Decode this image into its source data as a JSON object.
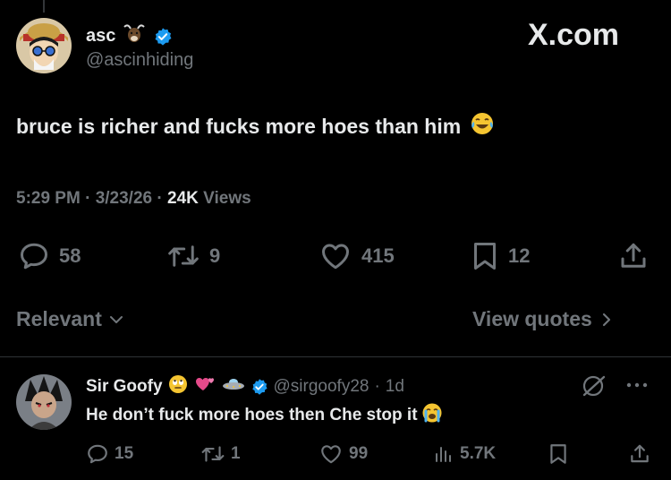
{
  "tweet": {
    "display_name": "asc",
    "handle": "@ascinhiding",
    "text": "bruce is richer and fucks more hoes than him",
    "time": "5:29 PM",
    "date": "3/23/26",
    "views_count": "24K",
    "views_label": "Views",
    "replies": "58",
    "retweets": "9",
    "likes": "415",
    "bookmarks": "12"
  },
  "brand": {
    "logo_text": "X.com"
  },
  "sort": {
    "relevant_label": "Relevant",
    "view_quotes_label": "View quotes"
  },
  "reply": {
    "display_name": "Sir Goofy",
    "handle": "@sirgoofy28",
    "age": "1d",
    "text": "He don’t fuck more hoes then Che stop it",
    "replies": "15",
    "retweets": "1",
    "likes": "99",
    "views": "5.7K"
  },
  "colors": {
    "background": "#000000",
    "text": "#e7e9ea",
    "muted": "#71767b",
    "verified": "#1d9bf0",
    "divider": "#2f3336"
  }
}
